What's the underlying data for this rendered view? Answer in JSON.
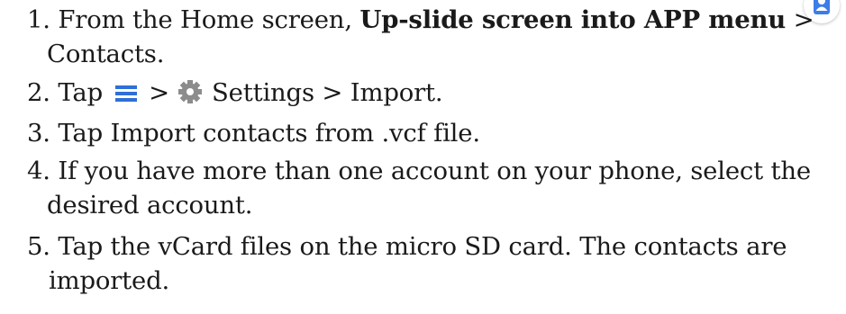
{
  "steps": [
    {
      "number": "1.",
      "pre": "From the Home screen, ",
      "bold": "Up-slide screen into APP menu",
      "post": " >",
      "continuation": "Contacts."
    },
    {
      "number": "2.",
      "pre": "Tap ",
      "mid": " > ",
      "post": " Settings > Import."
    },
    {
      "number": "3.",
      "text": "Tap Import contacts from .vcf file."
    },
    {
      "number": "4.",
      "text": "If you have more than one account on your phone, select the",
      "continuation": "desired account."
    },
    {
      "number": "5.",
      "text": "Tap the vCard files on the micro SD card. The contacts are",
      "continuation": "imported."
    }
  ],
  "icons": {
    "contacts_app": "contacts-app-icon",
    "menu": "menu-icon",
    "settings": "gear-icon"
  },
  "colors": {
    "menu_icon": "#2f6fd6",
    "gear_icon": "#8c8c8c",
    "contacts_icon": "#3b7de9"
  }
}
